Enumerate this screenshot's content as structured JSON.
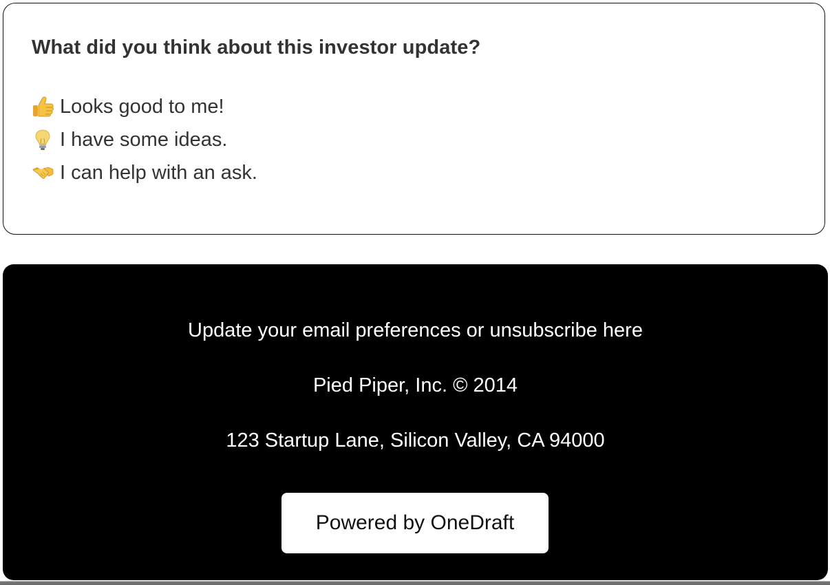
{
  "feedback": {
    "title": "What did you think about this investor update?",
    "options": [
      {
        "icon": "thumbs-up-icon",
        "label": "Looks good to me!"
      },
      {
        "icon": "light-bulb-icon",
        "label": "I have some ideas."
      },
      {
        "icon": "handshake-icon",
        "label": "I can help with an ask."
      }
    ]
  },
  "footer": {
    "preferences_link": "Update your email preferences or unsubscribe here",
    "company": "Pied Piper, Inc. © 2014",
    "address": "123 Startup Lane, Silicon Valley, CA 94000",
    "powered_by": "Powered by OneDraft"
  },
  "colors": {
    "card_border": "#111111",
    "text": "#333333",
    "footer_background": "#000000",
    "footer_text": "#ffffff",
    "button_background": "#ffffff"
  }
}
